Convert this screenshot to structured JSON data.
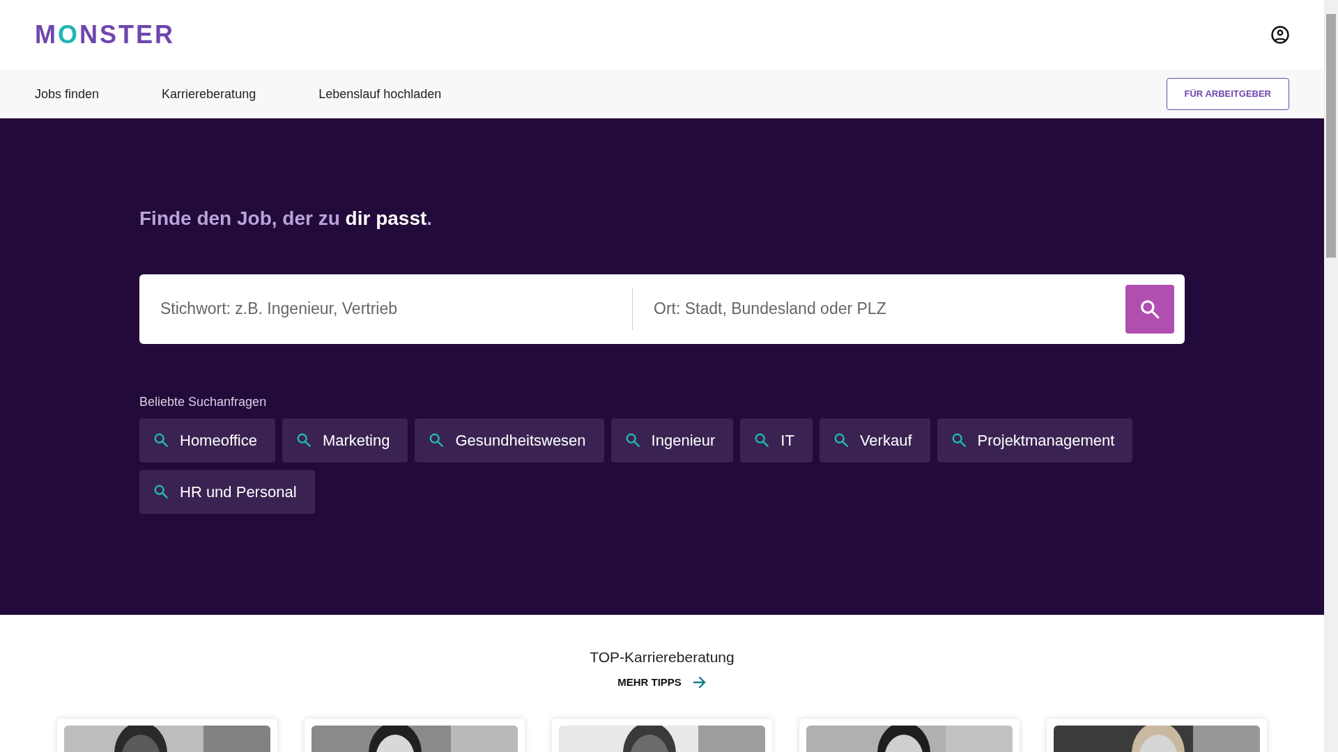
{
  "header": {
    "logo": "MONSTER"
  },
  "nav": {
    "items": [
      {
        "label": "Jobs finden"
      },
      {
        "label": "Karriereberatung"
      },
      {
        "label": "Lebenslauf hochladen"
      }
    ],
    "employer_button": "FÜR ARBEITGEBER"
  },
  "hero": {
    "headline": "Finde den Job, der zu **dir passt**.",
    "search": {
      "keyword_placeholder": "Stichwort: z.B. Ingenieur, Vertrieb",
      "location_placeholder": "Ort: Stadt, Bundesland oder PLZ"
    },
    "popular_label": "Beliebte Suchanfragen",
    "popular": [
      "Homeoffice",
      "Marketing",
      "Gesundheitswesen",
      "Ingenieur",
      "IT",
      "Verkauf",
      "Projektmanagement",
      "HR und Personal"
    ]
  },
  "advice": {
    "title": "TOP-Karriereberatung",
    "more_link": "MEHR TIPPS"
  }
}
